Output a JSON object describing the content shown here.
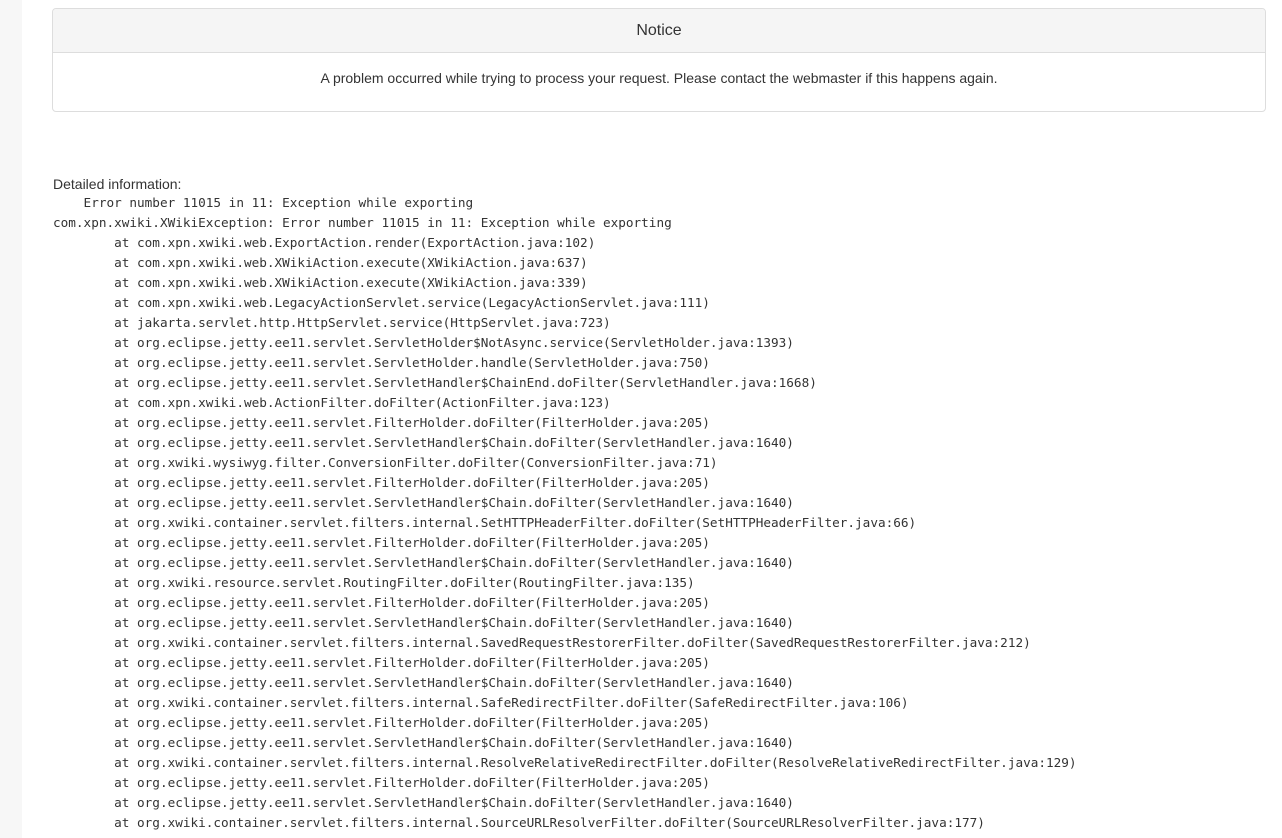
{
  "notice": {
    "title": "Notice",
    "message": "A problem occurred while trying to process your request. Please contact the webmaster if this happens again."
  },
  "details": {
    "label": "Detailed information:",
    "lines": [
      "    Error number 11015 in 11: Exception while exporting",
      "com.xpn.xwiki.XWikiException: Error number 11015 in 11: Exception while exporting",
      "        at com.xpn.xwiki.web.ExportAction.render(ExportAction.java:102)",
      "        at com.xpn.xwiki.web.XWikiAction.execute(XWikiAction.java:637)",
      "        at com.xpn.xwiki.web.XWikiAction.execute(XWikiAction.java:339)",
      "        at com.xpn.xwiki.web.LegacyActionServlet.service(LegacyActionServlet.java:111)",
      "        at jakarta.servlet.http.HttpServlet.service(HttpServlet.java:723)",
      "        at org.eclipse.jetty.ee11.servlet.ServletHolder$NotAsync.service(ServletHolder.java:1393)",
      "        at org.eclipse.jetty.ee11.servlet.ServletHolder.handle(ServletHolder.java:750)",
      "        at org.eclipse.jetty.ee11.servlet.ServletHandler$ChainEnd.doFilter(ServletHandler.java:1668)",
      "        at com.xpn.xwiki.web.ActionFilter.doFilter(ActionFilter.java:123)",
      "        at org.eclipse.jetty.ee11.servlet.FilterHolder.doFilter(FilterHolder.java:205)",
      "        at org.eclipse.jetty.ee11.servlet.ServletHandler$Chain.doFilter(ServletHandler.java:1640)",
      "        at org.xwiki.wysiwyg.filter.ConversionFilter.doFilter(ConversionFilter.java:71)",
      "        at org.eclipse.jetty.ee11.servlet.FilterHolder.doFilter(FilterHolder.java:205)",
      "        at org.eclipse.jetty.ee11.servlet.ServletHandler$Chain.doFilter(ServletHandler.java:1640)",
      "        at org.xwiki.container.servlet.filters.internal.SetHTTPHeaderFilter.doFilter(SetHTTPHeaderFilter.java:66)",
      "        at org.eclipse.jetty.ee11.servlet.FilterHolder.doFilter(FilterHolder.java:205)",
      "        at org.eclipse.jetty.ee11.servlet.ServletHandler$Chain.doFilter(ServletHandler.java:1640)",
      "        at org.xwiki.resource.servlet.RoutingFilter.doFilter(RoutingFilter.java:135)",
      "        at org.eclipse.jetty.ee11.servlet.FilterHolder.doFilter(FilterHolder.java:205)",
      "        at org.eclipse.jetty.ee11.servlet.ServletHandler$Chain.doFilter(ServletHandler.java:1640)",
      "        at org.xwiki.container.servlet.filters.internal.SavedRequestRestorerFilter.doFilter(SavedRequestRestorerFilter.java:212)",
      "        at org.eclipse.jetty.ee11.servlet.FilterHolder.doFilter(FilterHolder.java:205)",
      "        at org.eclipse.jetty.ee11.servlet.ServletHandler$Chain.doFilter(ServletHandler.java:1640)",
      "        at org.xwiki.container.servlet.filters.internal.SafeRedirectFilter.doFilter(SafeRedirectFilter.java:106)",
      "        at org.eclipse.jetty.ee11.servlet.FilterHolder.doFilter(FilterHolder.java:205)",
      "        at org.eclipse.jetty.ee11.servlet.ServletHandler$Chain.doFilter(ServletHandler.java:1640)",
      "        at org.xwiki.container.servlet.filters.internal.ResolveRelativeRedirectFilter.doFilter(ResolveRelativeRedirectFilter.java:129)",
      "        at org.eclipse.jetty.ee11.servlet.FilterHolder.doFilter(FilterHolder.java:205)",
      "        at org.eclipse.jetty.ee11.servlet.ServletHandler$Chain.doFilter(ServletHandler.java:1640)",
      "        at org.xwiki.container.servlet.filters.internal.SourceURLResolverFilter.doFilter(SourceURLResolverFilter.java:177)"
    ]
  },
  "colors": {
    "panel_border": "#dddddd",
    "panel_heading_bg": "#f5f5f5",
    "text": "#333333",
    "left_strip": "#f7f7f7"
  }
}
